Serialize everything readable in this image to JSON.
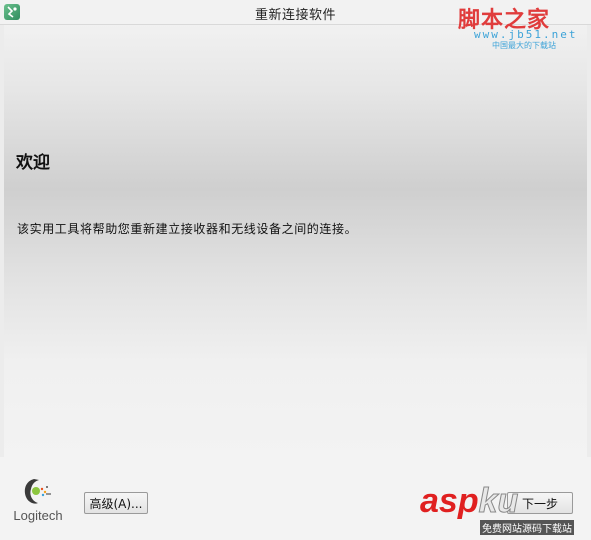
{
  "window": {
    "title": "重新连接软件"
  },
  "main": {
    "heading": "欢迎",
    "description": "该实用工具将帮助您重新建立接收器和无线设备之间的连接。"
  },
  "footer": {
    "logo_text": "Logitech",
    "advanced_button": "高级(A)...",
    "next_button": "下一步"
  },
  "watermarks": {
    "top_brand": "脚本之家",
    "top_url": "www.jb51.net",
    "top_tagline": "中国最大的下载站",
    "bottom_brand_a": "asp",
    "bottom_brand_b": "ku",
    "bottom_tagline": "免费网站源码下载站"
  },
  "colors": {
    "accent_green": "#2f8d5e",
    "watermark_red": "#e03c3c",
    "watermark_blue": "#3da3d8"
  }
}
